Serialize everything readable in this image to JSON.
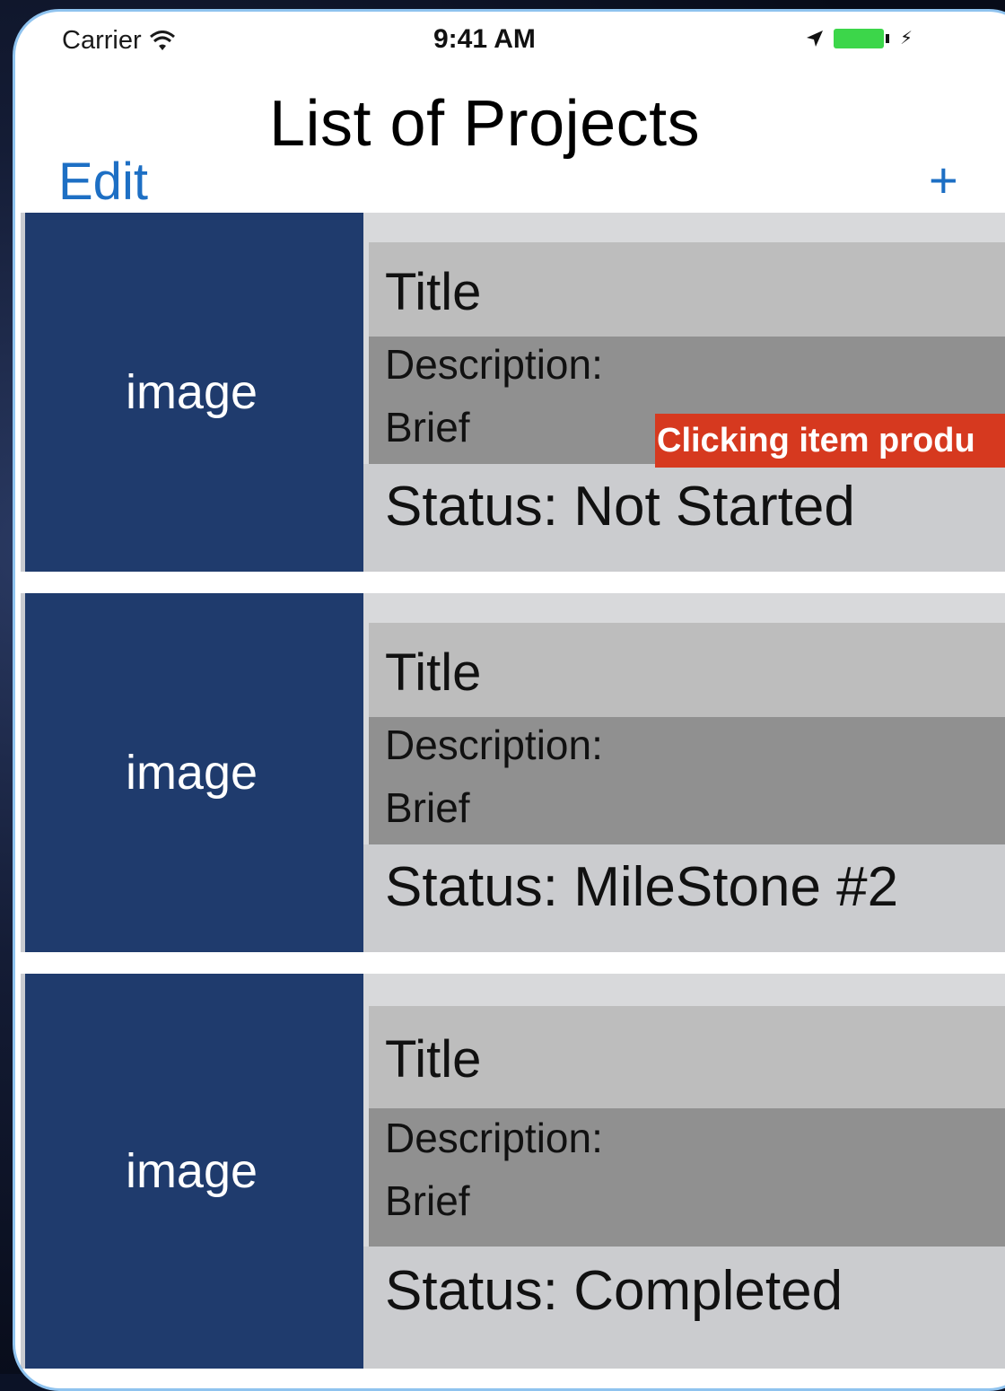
{
  "status_bar": {
    "carrier": "Carrier",
    "time": "9:41 AM",
    "battery_color": "#3cd64a"
  },
  "nav": {
    "title": "List of Projects",
    "edit_label": "Edit",
    "add_label": "+",
    "accent_color": "#1d6fc4"
  },
  "projects": [
    {
      "image_label": "image",
      "title": "Title",
      "description_label": "Description:",
      "description": "Brief",
      "status": "Status: Not Started"
    },
    {
      "image_label": "image",
      "title": "Title",
      "description_label": "Description:",
      "description": "Brief",
      "status": "Status: MileStone #2"
    },
    {
      "image_label": "image",
      "title": "Title",
      "description_label": "Description:",
      "description": "Brief",
      "status": "Status: Completed"
    }
  ],
  "tooltip": {
    "text": "Clicking item produ",
    "color": "#d6391f"
  },
  "icons": [
    "wifi-icon",
    "location-icon",
    "battery-icon",
    "bolt-icon"
  ]
}
